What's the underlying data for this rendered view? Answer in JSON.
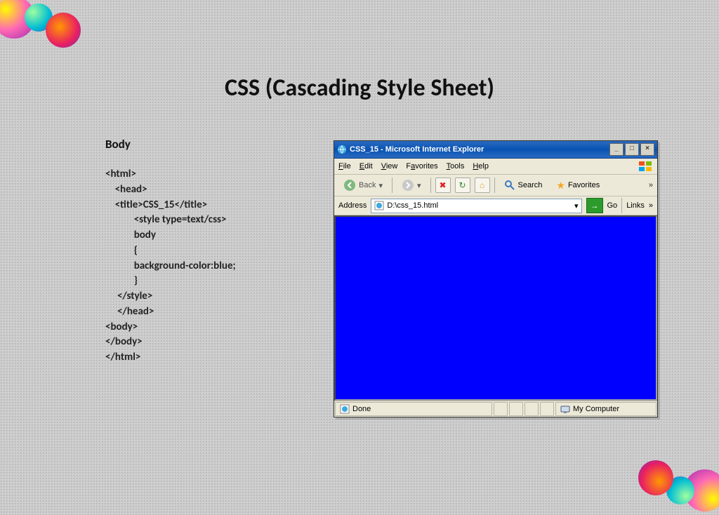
{
  "page": {
    "title": "CSS (Cascading Style Sheet)",
    "section_label": "Body"
  },
  "code": {
    "l1": "<html>",
    "l2": "    <head>",
    "l3": "    <title>CSS_15</title>",
    "l4": "            <style type=text/css>",
    "l5": "            body",
    "l6": "            {",
    "l7": "            background-color:blue;",
    "l8": "            }",
    "l9": "     </style>",
    "l10": "     </head>",
    "l11": "<body>",
    "l12": "</body>",
    "l13": "</html>"
  },
  "ie": {
    "title": "CSS_15 - Microsoft Internet Explorer",
    "menu": {
      "file": "File",
      "edit": "Edit",
      "view": "View",
      "favorites": "Favorites",
      "tools": "Tools",
      "help": "Help"
    },
    "toolbar": {
      "back": "Back",
      "search": "Search",
      "favorites": "Favorites",
      "chevrons": "»"
    },
    "address": {
      "label": "Address",
      "value": "D:\\css_15.html",
      "go": "Go",
      "links": "Links",
      "chevrons": "»"
    },
    "status": {
      "done": "Done",
      "zone": "My Computer"
    }
  }
}
